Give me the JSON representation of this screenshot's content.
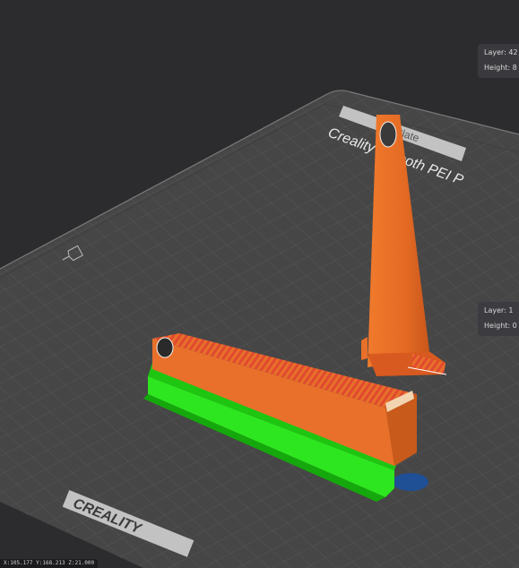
{
  "layer_top": {
    "layer": "Layer: 42",
    "height": "Height: 8"
  },
  "layer_bottom": {
    "layer": "Layer: 1",
    "height": "Height: 0"
  },
  "plate": {
    "plate_tab_label": "Plate",
    "plate_name": "Creality Smooth PEI P",
    "brand_label": "CREALITY"
  },
  "status": {
    "coords": "X:105.177 Y:168.213 Z:21.000"
  },
  "colors": {
    "background": "#2c2c2e",
    "bed": "#484848",
    "grid": "#6a6a6a",
    "part_orange": "#e8702a",
    "part_red": "#e0503a",
    "part_green": "#2ee61f",
    "part_blue": "#1f5fa8",
    "badge_bg": "#3c3c40"
  },
  "icons": [
    "home-sensor-icon"
  ]
}
